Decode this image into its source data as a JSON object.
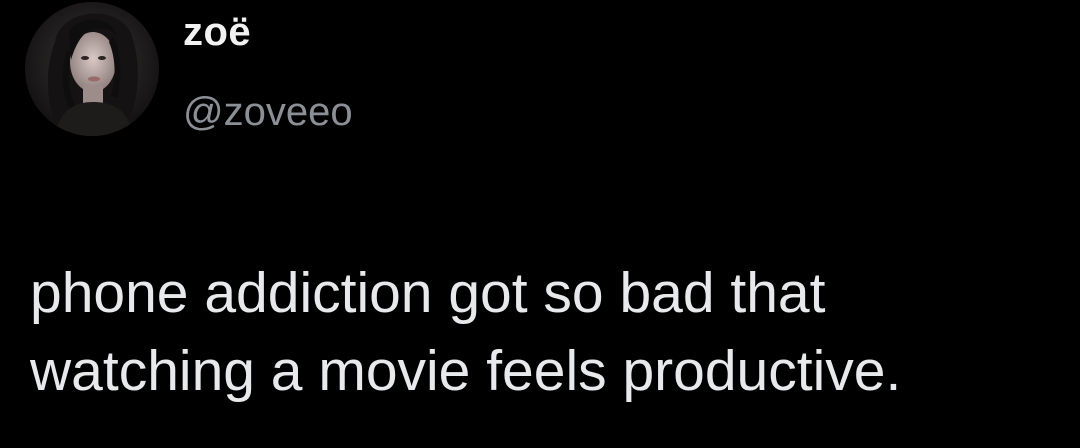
{
  "author": {
    "display_name": "zoë",
    "handle": "@zoveeo",
    "avatar_icon": "profile-photo"
  },
  "tweet": {
    "lines": [
      "phone addiction got so bad that",
      "watching a movie feels productive."
    ]
  },
  "colors": {
    "background": "#000000",
    "text_primary": "#e7e9ea",
    "text_secondary": "#8b9096"
  }
}
